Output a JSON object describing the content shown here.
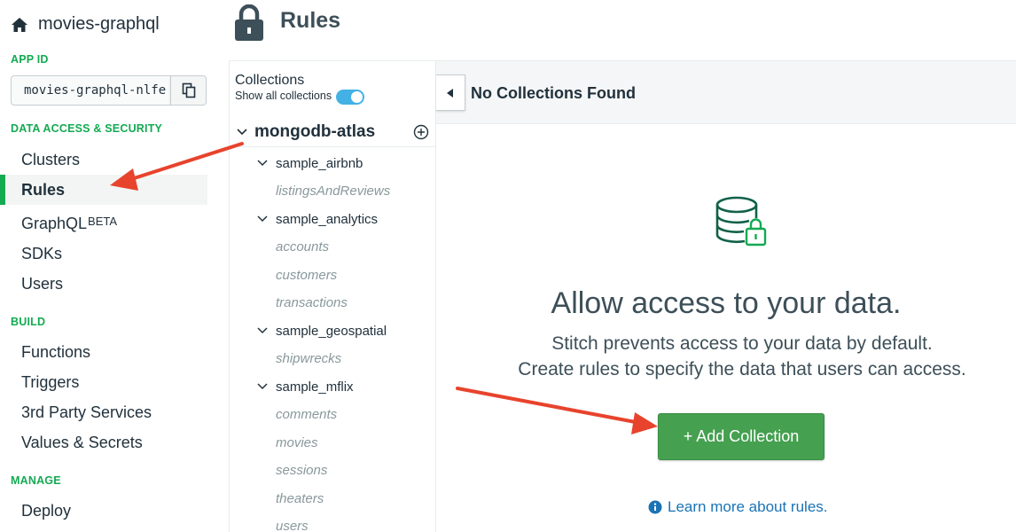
{
  "app": {
    "name": "movies-graphql",
    "home_icon": "home-icon"
  },
  "app_id": {
    "label": "APP ID",
    "value": "movies-graphql-nlfe",
    "copy_icon": "copy-icon"
  },
  "sidebar": {
    "sections": [
      {
        "label": "DATA ACCESS & SECURITY"
      },
      {
        "label": "BUILD"
      },
      {
        "label": "MANAGE"
      }
    ],
    "items": [
      {
        "label": "Clusters"
      },
      {
        "label": "Rules",
        "active": true
      },
      {
        "label": "GraphQL",
        "badge": "BETA"
      },
      {
        "label": "SDKs"
      },
      {
        "label": "Users"
      },
      {
        "label": "Functions"
      },
      {
        "label": "Triggers"
      },
      {
        "label": "3rd Party Services"
      },
      {
        "label": "Values & Secrets"
      },
      {
        "label": "Deploy"
      }
    ]
  },
  "header": {
    "title": "Rules",
    "icon": "lock-icon"
  },
  "collections_panel": {
    "title": "Collections",
    "toggle_label": "Show all collections",
    "toggle_on": true,
    "cluster": "mongodb-atlas",
    "databases": [
      {
        "name": "sample_airbnb",
        "collections": [
          "listingsAndReviews"
        ]
      },
      {
        "name": "sample_analytics",
        "collections": [
          "accounts",
          "customers",
          "transactions"
        ]
      },
      {
        "name": "sample_geospatial",
        "collections": [
          "shipwrecks"
        ]
      },
      {
        "name": "sample_mflix",
        "collections": [
          "comments",
          "movies",
          "sessions",
          "theaters",
          "users"
        ]
      }
    ]
  },
  "main": {
    "bar_title": "No Collections Found",
    "empty_title": "Allow access to your data.",
    "empty_line1": "Stitch prevents access to your data by default.",
    "empty_line2": "Create rules to specify the data that users can access.",
    "add_button": "+ Add Collection",
    "learn_link": "Learn more about rules."
  },
  "colors": {
    "accent_green": "#13aa52",
    "button_green": "#45a050",
    "link_blue": "#1a73b5",
    "toggle_blue": "#43b1e5",
    "annotation_red": "#e8432d"
  }
}
